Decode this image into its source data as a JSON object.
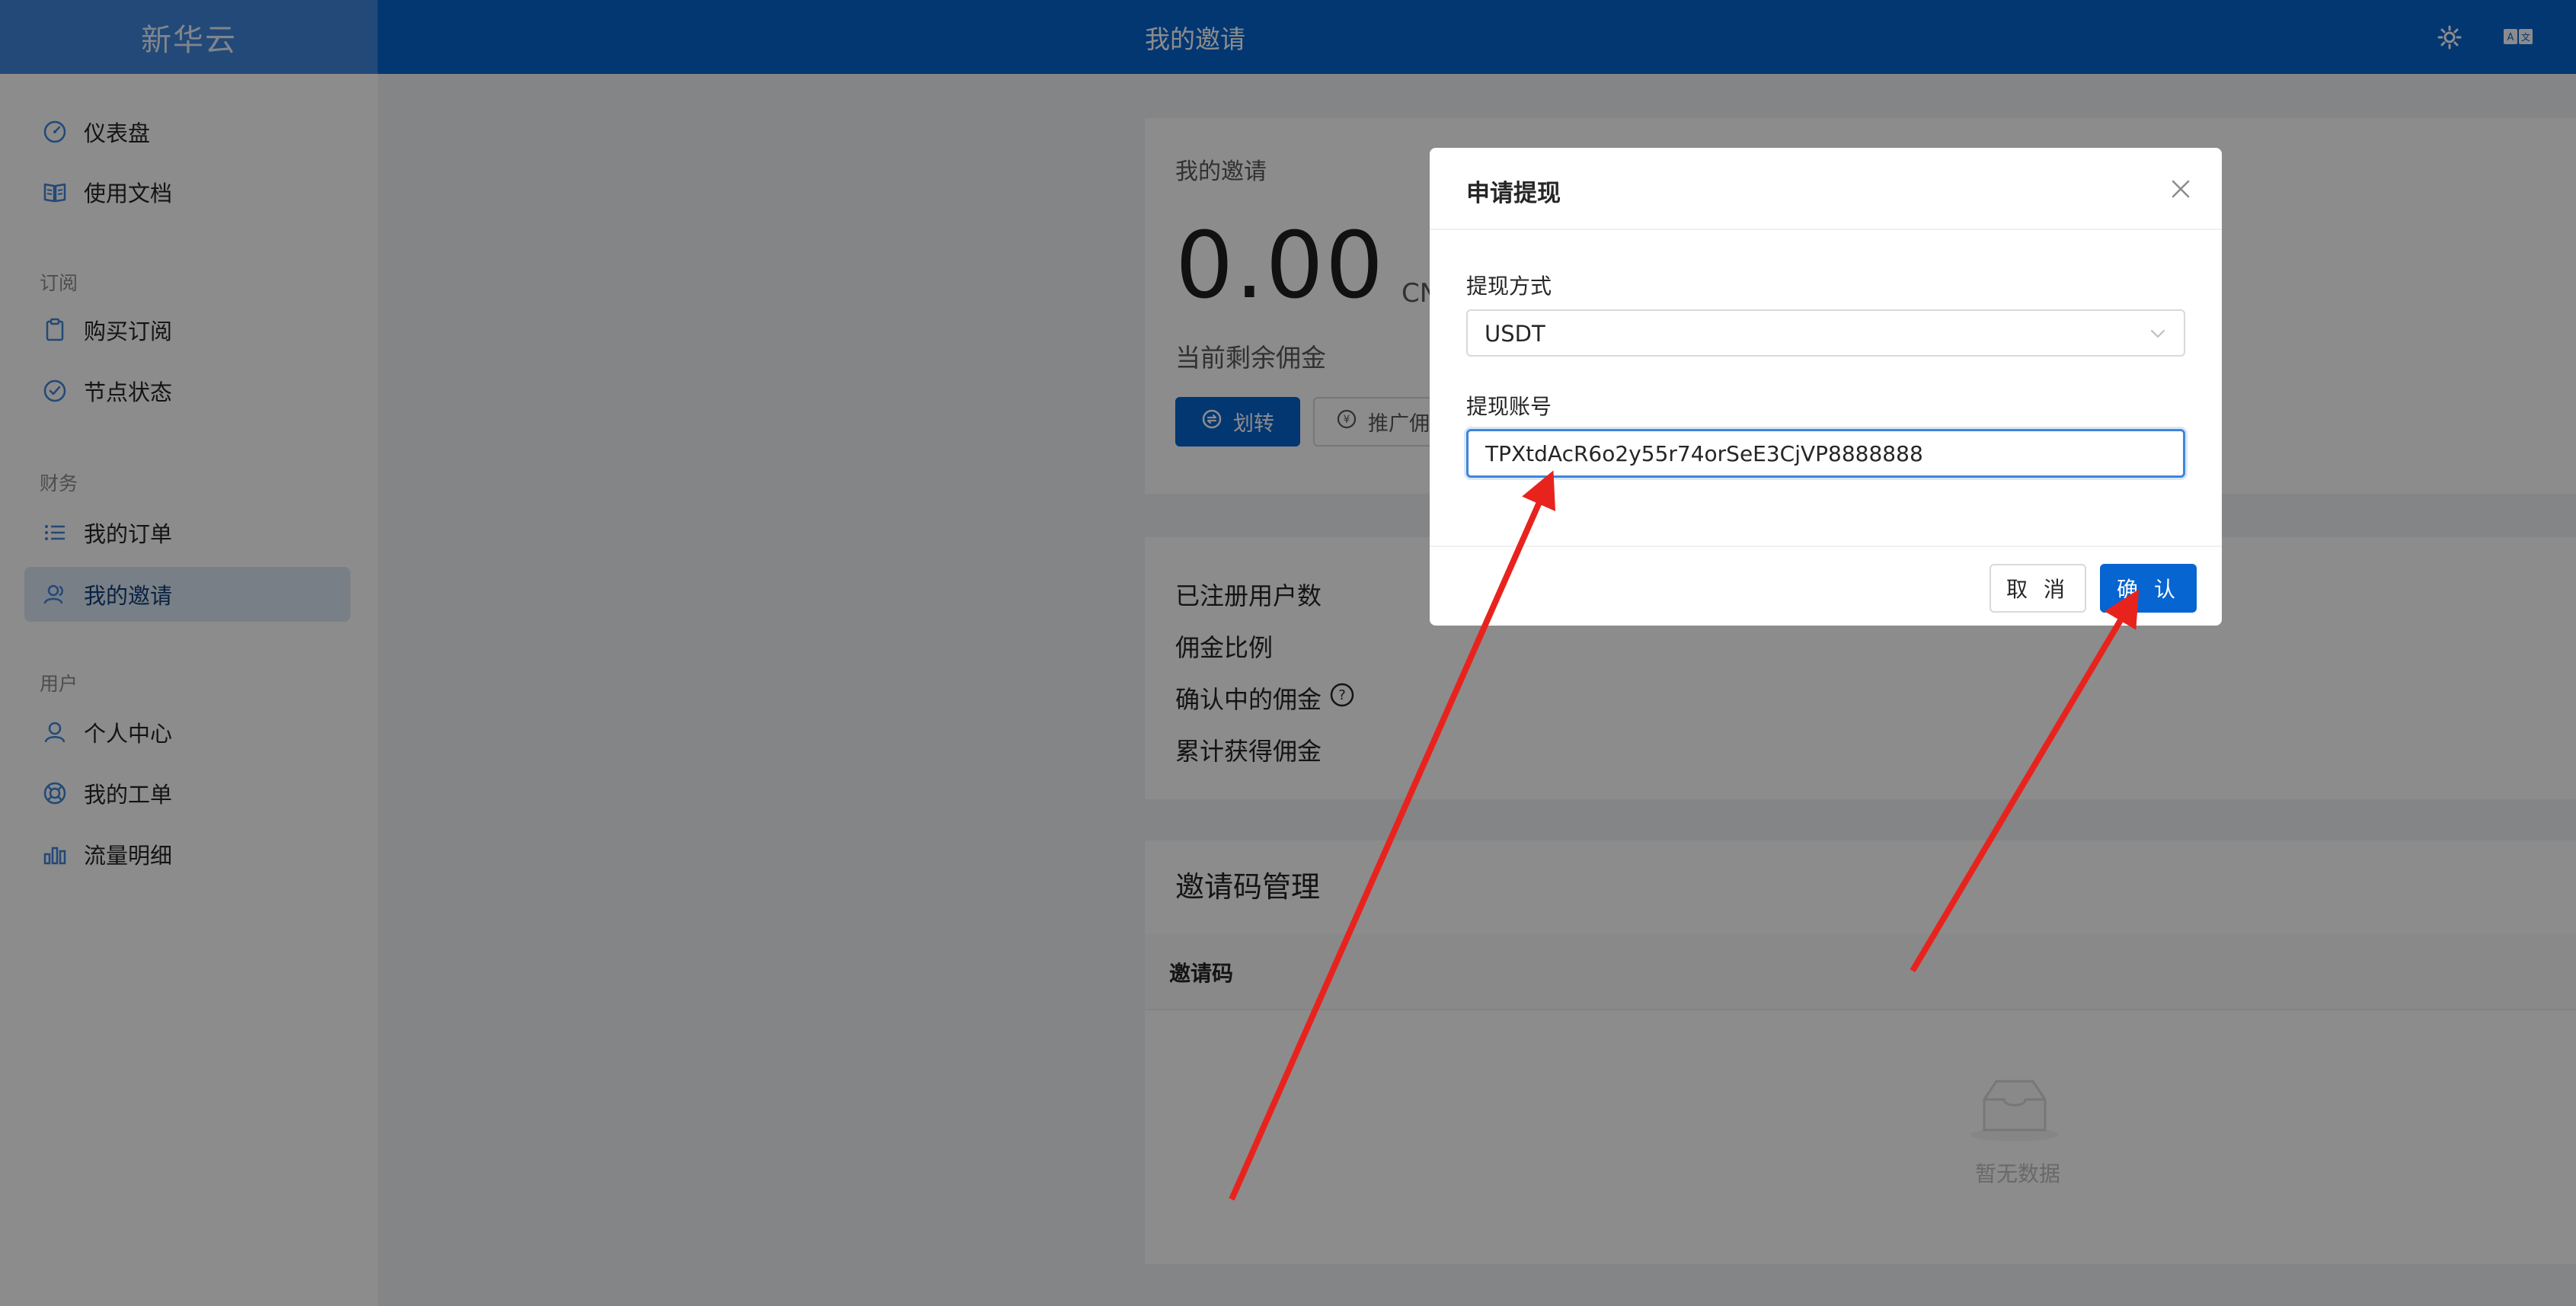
{
  "app": {
    "brand": "新华云",
    "page_title": "我的邀请"
  },
  "header_icons": [
    "theme-icon",
    "translate-icon"
  ],
  "sidebar": {
    "items": [
      {
        "label": "仪表盘",
        "icon": "dashboard-icon"
      },
      {
        "label": "使用文档",
        "icon": "book-icon"
      },
      {
        "label": "购买订阅",
        "icon": "clipboard-icon"
      },
      {
        "label": "节点状态",
        "icon": "check-circle-icon"
      },
      {
        "label": "我的订单",
        "icon": "list-icon"
      },
      {
        "label": "我的邀请",
        "icon": "users-icon",
        "active": true
      },
      {
        "label": "个人中心",
        "icon": "user-icon"
      },
      {
        "label": "我的工单",
        "icon": "lifebuoy-icon"
      },
      {
        "label": "流量明细",
        "icon": "bar-chart-icon"
      }
    ],
    "groups": {
      "subscription": "订阅",
      "finance": "财务",
      "user": "用户"
    }
  },
  "invite_card": {
    "title": "我的邀请",
    "amount": "0.00",
    "unit": "CN",
    "subtitle": "当前剩余佣金",
    "transfer_button": "划转",
    "promo_button": "推广佣"
  },
  "stats": {
    "registered_users": "已注册用户数",
    "commission_rate": "佣金比例",
    "pending_commission": "确认中的佣金",
    "total_commission": "累计获得佣金"
  },
  "invite_codes": {
    "title": "邀请码管理",
    "column_header": "邀请码",
    "empty_text": "暂无数据"
  },
  "modal": {
    "title": "申请提现",
    "method_label": "提现方式",
    "method_value": "USDT",
    "account_label": "提现账号",
    "account_value": "TPXtdAcR6o2y55r74orSeE3CjVP8888888",
    "cancel_label": "取 消",
    "confirm_label": "确 认"
  },
  "colors": {
    "primary": "#0665d0",
    "brand_bg": "#3f86da",
    "annotation_arrow": "#e8231e"
  }
}
